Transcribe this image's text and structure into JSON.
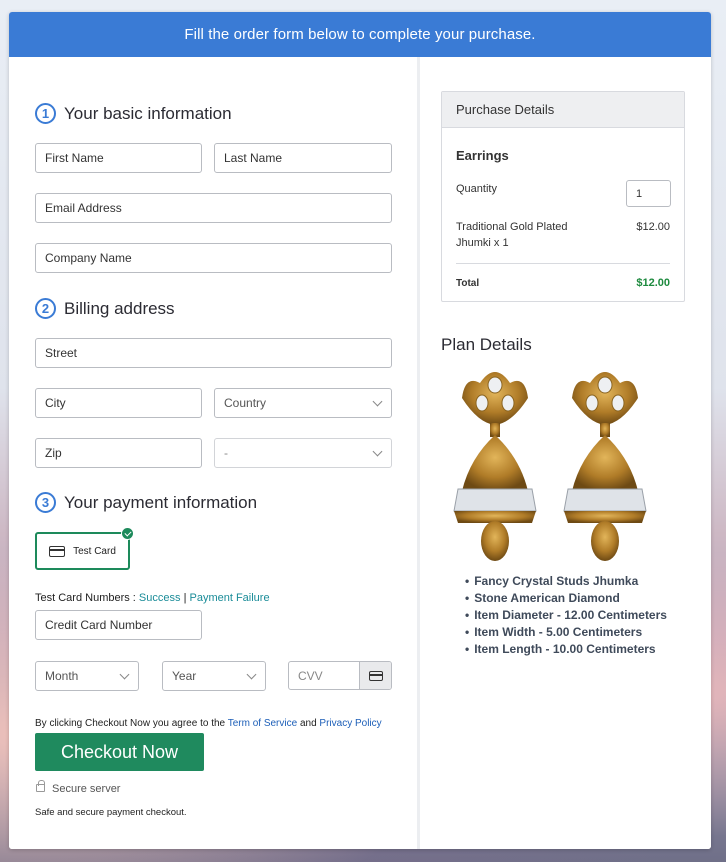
{
  "banner": {
    "text": "Fill the order form below to complete your purchase."
  },
  "sections": {
    "basic": {
      "number": "1",
      "title": "Your basic information"
    },
    "billing": {
      "number": "2",
      "title": "Billing address"
    },
    "payment": {
      "number": "3",
      "title": "Your payment information"
    }
  },
  "fields": {
    "first_name": "First Name",
    "last_name": "Last Name",
    "email": "Email Address",
    "company": "Company Name",
    "street": "Street",
    "city": "City",
    "country": "Country",
    "zip": "Zip",
    "state": "-",
    "card_number": "Credit Card Number",
    "month": "Month",
    "year": "Year",
    "cvv": "CVV"
  },
  "payment": {
    "test_card_label": "Test Card",
    "test_numbers_prefix": "Test Card Numbers : ",
    "success": "Success",
    "separator": "|",
    "failure": "Payment Failure"
  },
  "terms": {
    "prefix": "By clicking Checkout Now you agree to the ",
    "tos": "Term of Service",
    "and": " and ",
    "privacy": "Privacy Policy"
  },
  "checkout": {
    "button": "Checkout Now",
    "secure": "Secure server",
    "safe": "Safe and secure payment checkout."
  },
  "purchase": {
    "header": "Purchase Details",
    "product": "Earrings",
    "quantity_label": "Quantity",
    "quantity_value": "1",
    "item_line1": "Traditional Gold Plated",
    "item_line2": "Jhumki x 1",
    "item_price": "$12.00",
    "total_label": "Total",
    "total_value": "$12.00",
    "total_color": "#1d8a3e"
  },
  "plan": {
    "title": "Plan Details",
    "features": [
      "Fancy Crystal Studs Jhumka",
      "Stone American Diamond",
      "Item Diameter - 12.00 Centimeters",
      "Item Width - 5.00 Centimeters",
      "Item Length - 10.00 Centimeters"
    ]
  },
  "colors": {
    "accent": "#3a7bd5",
    "checkout": "#1f8a5e"
  }
}
